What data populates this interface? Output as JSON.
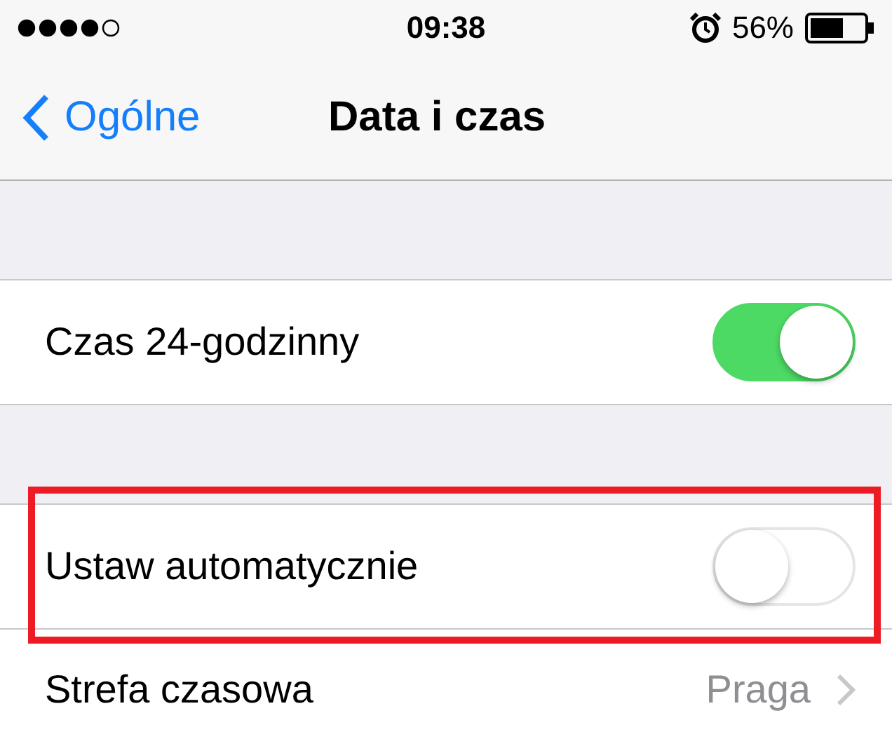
{
  "status_bar": {
    "time": "09:38",
    "battery": "56%"
  },
  "nav": {
    "back": "Ogólne",
    "title": "Data i czas"
  },
  "sections": [
    {
      "rows": [
        {
          "kind": "toggle",
          "label": "Czas 24-godzinny",
          "on": true,
          "highlighted": false
        }
      ]
    },
    {
      "rows": [
        {
          "kind": "toggle",
          "label": "Ustaw automatycznie",
          "on": false,
          "highlighted": true
        },
        {
          "kind": "link",
          "label": "Strefa czasowa",
          "value": "Praga",
          "highlighted": false
        }
      ]
    }
  ]
}
